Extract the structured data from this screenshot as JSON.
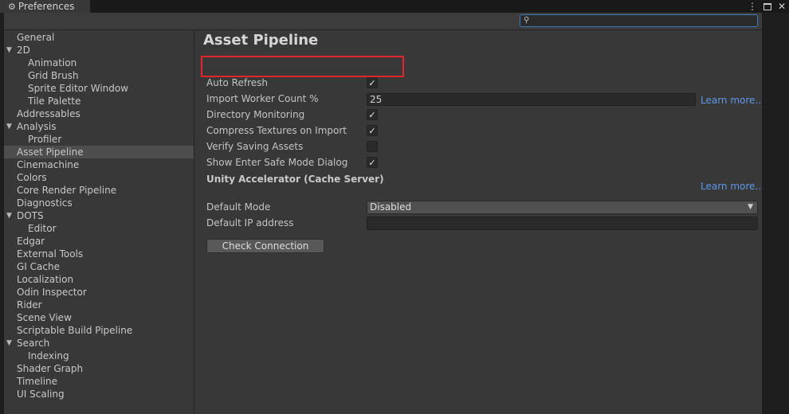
{
  "window": {
    "title": "Preferences",
    "tab_icon": "gear-icon"
  },
  "search": {
    "placeholder": "",
    "value": ""
  },
  "sidebar": {
    "items": [
      {
        "label": "General",
        "indent": 0,
        "arrow": false
      },
      {
        "label": "2D",
        "indent": 0,
        "arrow": true
      },
      {
        "label": "Animation",
        "indent": 1,
        "arrow": false
      },
      {
        "label": "Grid Brush",
        "indent": 1,
        "arrow": false
      },
      {
        "label": "Sprite Editor Window",
        "indent": 1,
        "arrow": false
      },
      {
        "label": "Tile Palette",
        "indent": 1,
        "arrow": false
      },
      {
        "label": "Addressables",
        "indent": 0,
        "arrow": false
      },
      {
        "label": "Analysis",
        "indent": 0,
        "arrow": true
      },
      {
        "label": "Profiler",
        "indent": 1,
        "arrow": false
      },
      {
        "label": "Asset Pipeline",
        "indent": 0,
        "arrow": false,
        "selected": true
      },
      {
        "label": "Cinemachine",
        "indent": 0,
        "arrow": false
      },
      {
        "label": "Colors",
        "indent": 0,
        "arrow": false
      },
      {
        "label": "Core Render Pipeline",
        "indent": 0,
        "arrow": false
      },
      {
        "label": "Diagnostics",
        "indent": 0,
        "arrow": false
      },
      {
        "label": "DOTS",
        "indent": 0,
        "arrow": true
      },
      {
        "label": "Editor",
        "indent": 1,
        "arrow": false
      },
      {
        "label": "Edgar",
        "indent": 0,
        "arrow": false
      },
      {
        "label": "External Tools",
        "indent": 0,
        "arrow": false
      },
      {
        "label": "GI Cache",
        "indent": 0,
        "arrow": false
      },
      {
        "label": "Localization",
        "indent": 0,
        "arrow": false
      },
      {
        "label": "Odin Inspector",
        "indent": 0,
        "arrow": false
      },
      {
        "label": "Rider",
        "indent": 0,
        "arrow": false
      },
      {
        "label": "Scene View",
        "indent": 0,
        "arrow": false
      },
      {
        "label": "Scriptable Build Pipeline",
        "indent": 0,
        "arrow": false
      },
      {
        "label": "Search",
        "indent": 0,
        "arrow": true
      },
      {
        "label": "Indexing",
        "indent": 1,
        "arrow": false
      },
      {
        "label": "Shader Graph",
        "indent": 0,
        "arrow": false
      },
      {
        "label": "Timeline",
        "indent": 0,
        "arrow": false
      },
      {
        "label": "UI Scaling",
        "indent": 0,
        "arrow": false
      }
    ]
  },
  "main": {
    "title": "Asset Pipeline",
    "settings": {
      "auto_refresh": {
        "label": "Auto Refresh",
        "checked": true
      },
      "import_worker_count": {
        "label": "Import Worker Count %",
        "value": "25"
      },
      "directory_monitoring": {
        "label": "Directory Monitoring",
        "checked": true
      },
      "compress_textures": {
        "label": "Compress Textures on Import",
        "checked": true
      },
      "verify_saving": {
        "label": "Verify Saving Assets",
        "checked": false
      },
      "safe_mode_dialog": {
        "label": "Show Enter Safe Mode Dialog",
        "checked": true
      }
    },
    "learn_more_1": "Learn more...",
    "accelerator": {
      "heading": "Unity Accelerator (Cache Server)",
      "learn_more": "Learn more...",
      "default_mode_label": "Default Mode",
      "default_mode_value": "Disabled",
      "default_ip_label": "Default IP address",
      "default_ip_value": "",
      "check_button": "Check Connection"
    }
  },
  "colors": {
    "highlight": "#e0262a",
    "link": "#5e98e8",
    "selection": "#4d4d4d",
    "search_focus": "#3a79bb"
  },
  "check_glyph": "✓"
}
